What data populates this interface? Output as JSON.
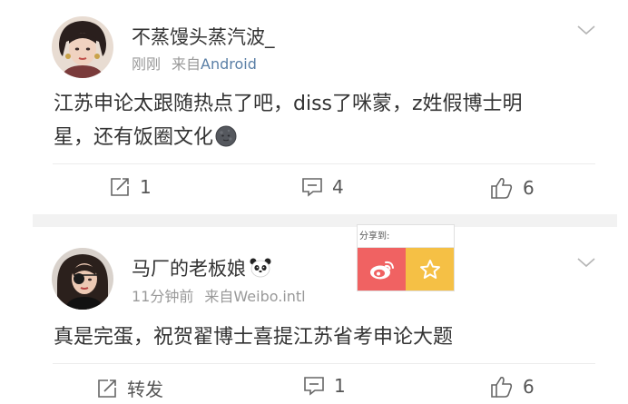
{
  "posts": [
    {
      "username": "不蒸馒头蒸汽波_",
      "time": "刚刚",
      "from_label": "来自",
      "source": "Android",
      "content_line1": "江苏申论太跟随热点了吧，diss了咪蒙，z姓假博士明",
      "content_line2": "星，还有饭圈文化",
      "content_emoji": "new-moon-face-emoji",
      "actions": {
        "repost": "1",
        "comment": "4",
        "like": "6"
      }
    },
    {
      "username": "马厂的老板娘",
      "username_emoji": "panda-emoji",
      "time": "11分钟前",
      "from_label": "来自",
      "source": "Weibo.intl",
      "content_line1": "真是完蛋，祝贺翟博士喜提江苏省考申论大题",
      "actions": {
        "repost": "转发",
        "comment": "1",
        "like": "6"
      }
    }
  ],
  "share_popup": {
    "title": "分享到:",
    "options": [
      "weibo-icon",
      "star-icon"
    ]
  },
  "colors": {
    "source_link": "#5a7fa6",
    "meta_gray": "#999999",
    "weibo_red": "#f06262",
    "fav_yellow": "#f5c045"
  }
}
